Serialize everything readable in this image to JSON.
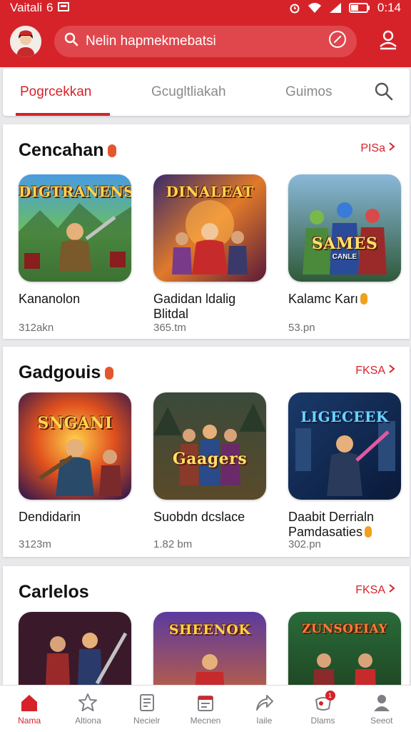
{
  "status_bar": {
    "carrier": "Vaitali",
    "network": "6",
    "time": "0:14"
  },
  "header": {
    "search_text": "Nelin hapmekmebatsi"
  },
  "tabs": [
    {
      "label": "Pogrcekkan"
    },
    {
      "label": "Gcugltliakah"
    },
    {
      "label": "Guimos"
    }
  ],
  "sections": [
    {
      "title": "Cencahan",
      "badge": "",
      "see_more": "PISa",
      "cards": [
        {
          "art": "DIGTRANENS",
          "name": "Kananolon",
          "size": "312akn"
        },
        {
          "art": "DINALEAT",
          "name": "Gadidan ldalig Blitdal",
          "size": "365.tm"
        },
        {
          "art": "SAMES",
          "art_sub": "CANLE",
          "name": "Kalamc Karı",
          "size": "53.pn"
        }
      ]
    },
    {
      "title": "Gadgouis",
      "badge": "",
      "see_more": "FKSA",
      "cards": [
        {
          "art": "SNGANI",
          "name": "Dendidarin",
          "size": "3123m"
        },
        {
          "art": "Gaagers",
          "name": "Suobdn dcslace",
          "size": "1.82 bm"
        },
        {
          "art": "LIGECEEK",
          "name": "Daabit Derrialn Pamdasaties",
          "size": "302.pn"
        }
      ]
    },
    {
      "title": "Carlelos",
      "see_more": "FKSA",
      "cards": [
        {
          "art": ""
        },
        {
          "art": "SHEENOK"
        },
        {
          "art": "ZUNSOEIAY"
        }
      ]
    }
  ],
  "bottom_nav": [
    {
      "label": "Nama",
      "icon": "home-icon"
    },
    {
      "label": "Altiona",
      "icon": "star-icon"
    },
    {
      "label": "Necielr",
      "icon": "document-icon"
    },
    {
      "label": "Mecnen",
      "icon": "calendar-icon"
    },
    {
      "label": "Iaile",
      "icon": "share-icon"
    },
    {
      "label": "Dlams",
      "icon": "game-icon",
      "badge": "1"
    },
    {
      "label": "Seeot",
      "icon": "user-icon"
    }
  ],
  "colors": {
    "accent": "#d6232a",
    "tab_text": "#8a8a8f",
    "background": "#e9e9ec",
    "badge": "#e4572e"
  }
}
